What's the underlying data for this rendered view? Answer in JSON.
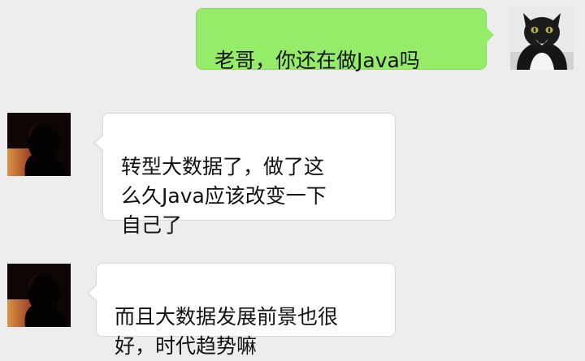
{
  "messages": [
    {
      "sender": "me",
      "text": "老哥，你还在做Java吗"
    },
    {
      "sender": "them",
      "text": "转型大数据了，做了这\n么久Java应该改变一下\n自己了"
    },
    {
      "sender": "them",
      "text": "而且大数据发展前景也很\n好，时代趋势嘛"
    }
  ],
  "colors": {
    "background": "#ededed",
    "my_bubble": "#95ec69",
    "their_bubble": "#ffffff"
  },
  "avatars": {
    "me": "black-cat-avatar-icon",
    "them": "silhouette-sunset-avatar-icon"
  }
}
